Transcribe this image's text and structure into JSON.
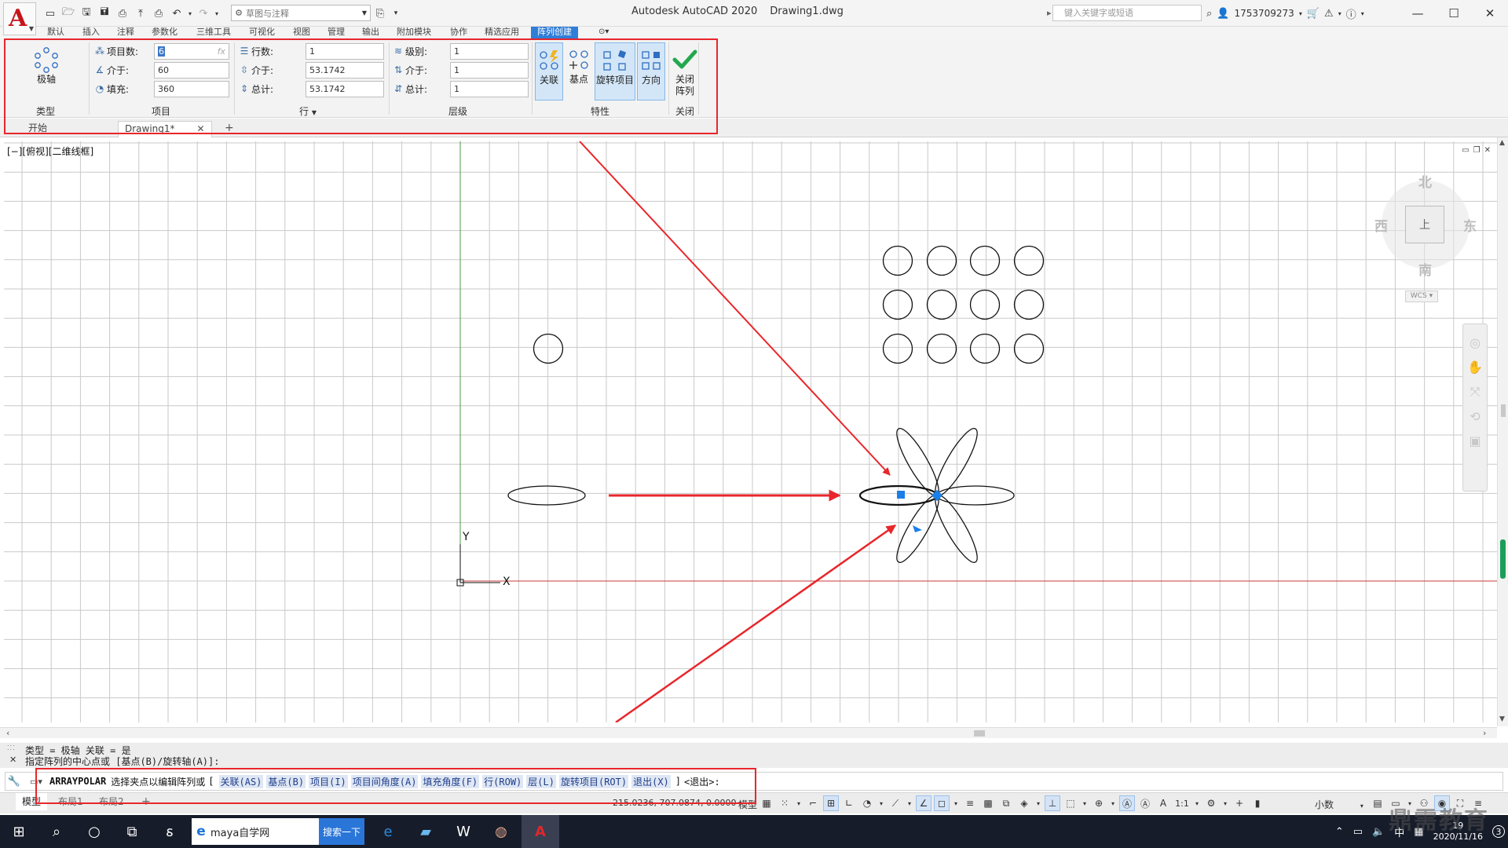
{
  "app": {
    "title": "Autodesk AutoCAD 2020",
    "filename": "Drawing1.dwg",
    "workspace": "草图与注释",
    "search_placeholder": "键入关键字或短语",
    "user": "1753709273"
  },
  "ribbon_tabs": [
    "默认",
    "插入",
    "注释",
    "参数化",
    "三维工具",
    "可视化",
    "视图",
    "管理",
    "输出",
    "附加模块",
    "协作",
    "精选应用",
    "阵列创建"
  ],
  "ribbon": {
    "type_panel": {
      "button": "极轴",
      "label": "类型"
    },
    "items_panel": {
      "label": "项目",
      "rows": [
        {
          "label": "项目数:",
          "value": "6",
          "fx": "fx"
        },
        {
          "label": "介于:",
          "value": "60"
        },
        {
          "label": "填充:",
          "value": "360"
        }
      ]
    },
    "rows_panel": {
      "label": "行",
      "rows": [
        {
          "label": "行数:",
          "value": "1"
        },
        {
          "label": "介于:",
          "value": "53.1742"
        },
        {
          "label": "总计:",
          "value": "53.1742"
        }
      ]
    },
    "levels_panel": {
      "label": "层级",
      "rows": [
        {
          "label": "级别:",
          "value": "1"
        },
        {
          "label": "介于:",
          "value": "1"
        },
        {
          "label": "总计:",
          "value": "1"
        }
      ]
    },
    "properties_panel": {
      "label": "特性",
      "buttons": [
        "关联",
        "基点",
        "旋转项目",
        "方向"
      ]
    },
    "close_panel": {
      "label": "关闭",
      "button_line1": "关闭",
      "button_line2": "阵列"
    }
  },
  "file_tabs": {
    "start": "开始",
    "drawing": "Drawing1*"
  },
  "viewport": {
    "label": "[−][俯视][二维线框]",
    "ucs_y": "Y",
    "ucs_x": "X"
  },
  "viewcube": {
    "north": "北",
    "south": "南",
    "east": "东",
    "west": "西",
    "face": "上",
    "wcs": "WCS"
  },
  "command": {
    "history": [
      "类型 = 极轴  关联 = 是",
      "指定阵列的中心点或 [基点(B)/旋转轴(A)]:"
    ],
    "name": "ARRAYPOLAR",
    "prompt": "选择夹点以编辑阵列或",
    "options": [
      "关联(AS)",
      "基点(B)",
      "项目(I)",
      "项目间角度(A)",
      "填充角度(F)",
      "行(ROW)",
      "层(L)",
      "旋转项目(ROT)",
      "退出(X)"
    ],
    "tail": "<退出>:"
  },
  "status": {
    "layout_tabs": [
      "模型",
      "布局1",
      "布局2"
    ],
    "coords": "215.0236, 707.0874, 0.0000",
    "model": "模型",
    "scale": "1:1",
    "units": "小数"
  },
  "taskbar": {
    "browser_text": "maya自学网",
    "search_button": "搜索一下",
    "ime": "中",
    "time": "19",
    "date": "2020/11/16",
    "badge": "3"
  },
  "watermark": "鼎需教育",
  "colors": {
    "accent": "#2f7ed8",
    "highlight_box": "#e8262b",
    "arrow": "#e8262b",
    "grip": "#1a7fe8",
    "autocad_red": "#c5141b"
  }
}
